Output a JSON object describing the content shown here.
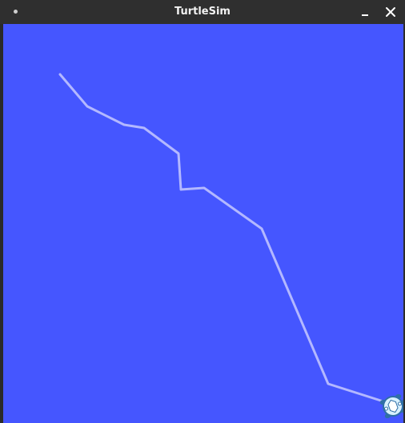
{
  "window": {
    "title": "TurtleSim",
    "minimize_icon": "minimize-icon",
    "close_icon": "close-icon"
  },
  "canvas": {
    "background_color": "#4556ff",
    "pen_color": "#b3b8ff",
    "turtle_icon": "turtle-icon"
  }
}
